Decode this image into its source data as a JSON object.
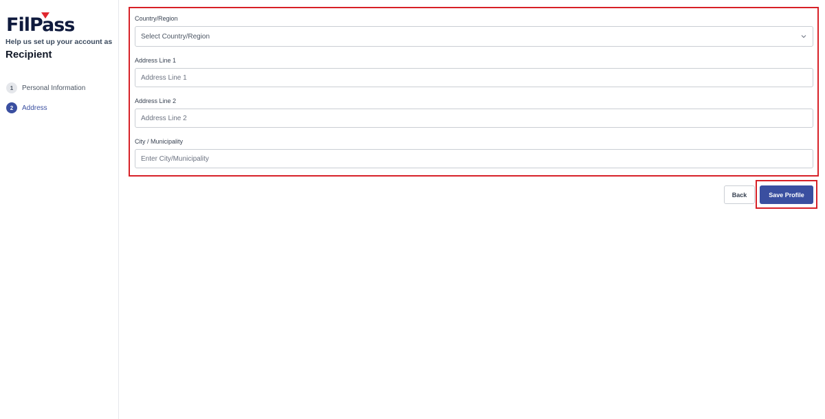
{
  "brand": {
    "logo_text": "FilPass",
    "accent_color": "#e0282f",
    "navy_color": "#0f1a3d"
  },
  "sidebar": {
    "subtitle": "Help us set up your account as",
    "role": "Recipient",
    "steps": [
      {
        "number": "1",
        "label": "Personal Information",
        "state": "completed"
      },
      {
        "number": "2",
        "label": "Address",
        "state": "active"
      }
    ]
  },
  "form": {
    "country": {
      "label": "Country/Region",
      "value": "Select Country/Region",
      "icon": "chevron-down-icon"
    },
    "address1": {
      "label": "Address Line 1",
      "placeholder": "Address Line 1"
    },
    "address2": {
      "label": "Address Line 2",
      "placeholder": "Address Line 2"
    },
    "city": {
      "label": "City / Municipality",
      "placeholder": "Enter City/Municipality"
    }
  },
  "actions": {
    "back_label": "Back",
    "save_label": "Save Profile",
    "primary_color": "#3a4fa0",
    "highlight_color": "#d71f26"
  }
}
